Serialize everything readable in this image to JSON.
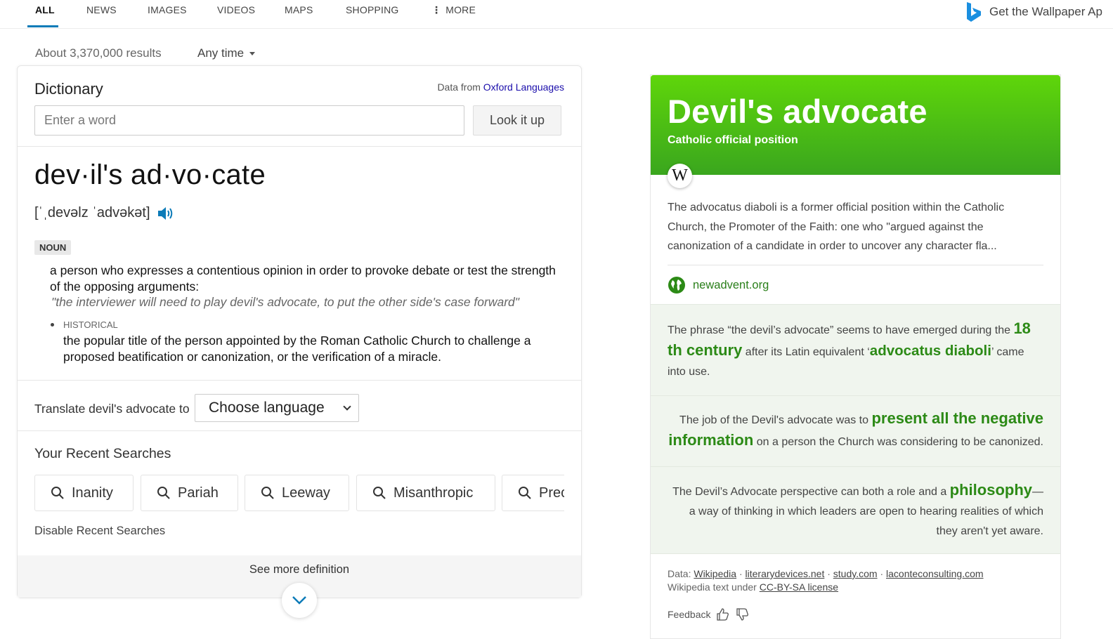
{
  "nav": {
    "tabs": [
      "ALL",
      "NEWS",
      "IMAGES",
      "VIDEOS",
      "MAPS",
      "SHOPPING"
    ],
    "more": "MORE",
    "wallpaper": "Get the Wallpaper Ap"
  },
  "results": {
    "count": "About 3,370,000 results",
    "time_filter": "Any time"
  },
  "dictionary": {
    "title": "Dictionary",
    "source_prefix": "Data from",
    "source_link": "Oxford Languages",
    "input_placeholder": "Enter a word",
    "lookup_label": "Look it up",
    "headword": "dev·il's ad·vo·cate",
    "pronunciation": "[ˈˌdevəlz ˈadvəkət]",
    "part_of_speech": "NOUN",
    "definition1": "a person who expresses a contentious opinion in order to provoke debate or test the strength of the opposing arguments:",
    "example": "\"the interviewer will need to play devil's advocate, to put the other side's case forward\"",
    "historical_label": "HISTORICAL",
    "definition2": "the popular title of the person appointed by the Roman Catholic Church to challenge a proposed beatification or canonization, or the verification of a miracle.",
    "translate_label": "Translate devil's advocate to",
    "language_select": "Choose language",
    "recent_title": "Your Recent Searches",
    "recent_searches": [
      "Inanity",
      "Pariah",
      "Leeway",
      "Misanthropic",
      "Prec"
    ],
    "disable_recent": "Disable Recent Searches",
    "see_more": "See more definition"
  },
  "knowledge_panel": {
    "title": "Devil's advocate",
    "subtitle": "Catholic official position",
    "wiki_letter": "W",
    "description": "The advocatus diaboli is a former official position within the Catholic Church, the Promoter of the Faith: one who \"argued against the canonization of a candidate in order to uncover any character fla...",
    "link": "newadvent.org",
    "fact1": {
      "part1": "The phrase “the devil’s advocate” seems to have emerged during the ",
      "hl1": "18 th century",
      "part2": " after its Latin equivalent ‘",
      "hl2": "advocatus diaboli",
      "part3": "’ came into use."
    },
    "fact2": {
      "part1": "The job of the Devil's advocate was to ",
      "hl1": "present all the negative information",
      "part2": " on a person the Church was considering to be canonized."
    },
    "fact3": {
      "part1": "The Devil’s Advocate perspective can both a role and a ",
      "hl1": "philosophy",
      "part2": "—a way of thinking in which leaders are open to hearing realities of which they aren't yet aware."
    },
    "footer": {
      "data_label": "Data:",
      "sources": [
        "Wikipedia",
        "literarydevices.net",
        "study.com",
        "laconteconsulting.com"
      ],
      "license_prefix": "Wikipedia text under",
      "license": "CC-BY-SA license",
      "feedback": "Feedback"
    }
  },
  "colors": {
    "accent_blue": "#0c7bb8",
    "panel_green": "#4cbf14",
    "highlight_green": "#2c8a16"
  }
}
